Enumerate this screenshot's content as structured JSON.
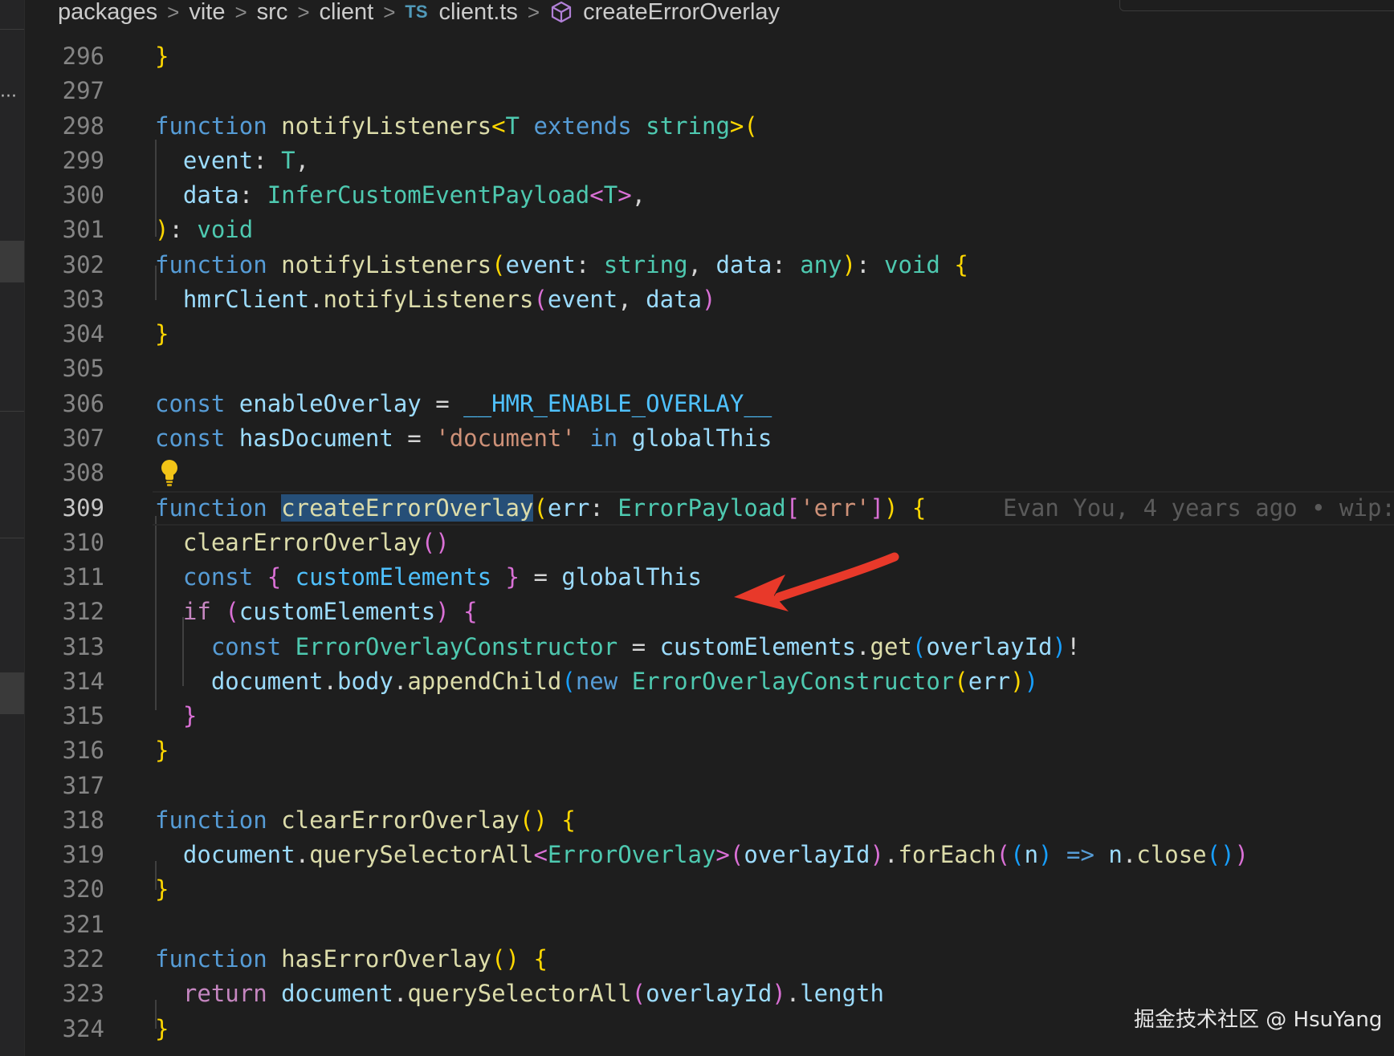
{
  "breadcrumb": {
    "items": [
      "packages",
      "vite",
      "src",
      "client"
    ],
    "file_badge": "TS",
    "file": "client.ts",
    "symbol": "createErrorOverlay",
    "separator": ">"
  },
  "editor": {
    "current_line": "309",
    "blame": "Evan You, 4 years ago • wip:",
    "line_numbers": [
      "296",
      "297",
      "298",
      "299",
      "300",
      "301",
      "302",
      "303",
      "304",
      "305",
      "306",
      "307",
      "308",
      "309",
      "310",
      "311",
      "312",
      "313",
      "314",
      "315",
      "316",
      "317",
      "318",
      "319",
      "320",
      "321",
      "322",
      "323",
      "324"
    ],
    "lines": [
      [
        [
          "b1",
          "}"
        ]
      ],
      [],
      [
        [
          "kw",
          "function"
        ],
        [
          "pn",
          " "
        ],
        [
          "fn",
          "notifyListeners"
        ],
        [
          "b1",
          "<"
        ],
        [
          "ty",
          "T"
        ],
        [
          "pn",
          " "
        ],
        [
          "kw",
          "extends"
        ],
        [
          "pn",
          " "
        ],
        [
          "ty",
          "string"
        ],
        [
          "b1",
          ">("
        ]
      ],
      [
        [
          "pn",
          "  "
        ],
        [
          "vr",
          "event"
        ],
        [
          "pn",
          ": "
        ],
        [
          "ty",
          "T"
        ],
        [
          "pn",
          ","
        ]
      ],
      [
        [
          "pn",
          "  "
        ],
        [
          "vr",
          "data"
        ],
        [
          "pn",
          ": "
        ],
        [
          "ty",
          "InferCustomEventPayload"
        ],
        [
          "b2",
          "<"
        ],
        [
          "ty",
          "T"
        ],
        [
          "b2",
          ">"
        ],
        [
          "pn",
          ","
        ]
      ],
      [
        [
          "b1",
          ")"
        ],
        [
          "pn",
          ": "
        ],
        [
          "ty",
          "void"
        ]
      ],
      [
        [
          "kw",
          "function"
        ],
        [
          "pn",
          " "
        ],
        [
          "fn",
          "notifyListeners"
        ],
        [
          "b1",
          "("
        ],
        [
          "vr",
          "event"
        ],
        [
          "pn",
          ": "
        ],
        [
          "ty",
          "string"
        ],
        [
          "pn",
          ", "
        ],
        [
          "vr",
          "data"
        ],
        [
          "pn",
          ": "
        ],
        [
          "ty",
          "any"
        ],
        [
          "b1",
          ")"
        ],
        [
          "pn",
          ": "
        ],
        [
          "ty",
          "void"
        ],
        [
          "pn",
          " "
        ],
        [
          "b1",
          "{"
        ]
      ],
      [
        [
          "pn",
          "  "
        ],
        [
          "vr",
          "hmrClient"
        ],
        [
          "pn",
          "."
        ],
        [
          "fn",
          "notifyListeners"
        ],
        [
          "b2",
          "("
        ],
        [
          "vr",
          "event"
        ],
        [
          "pn",
          ", "
        ],
        [
          "vr",
          "data"
        ],
        [
          "b2",
          ")"
        ]
      ],
      [
        [
          "b1",
          "}"
        ]
      ],
      [],
      [
        [
          "kw",
          "const"
        ],
        [
          "pn",
          " "
        ],
        [
          "vr",
          "enableOverlay"
        ],
        [
          "pn",
          " = "
        ],
        [
          "cst",
          "__HMR_ENABLE_OVERLAY__"
        ]
      ],
      [
        [
          "kw",
          "const"
        ],
        [
          "pn",
          " "
        ],
        [
          "vr",
          "hasDocument"
        ],
        [
          "pn",
          " = "
        ],
        [
          "str",
          "'document'"
        ],
        [
          "pn",
          " "
        ],
        [
          "kw",
          "in"
        ],
        [
          "pn",
          " "
        ],
        [
          "vr",
          "globalThis"
        ]
      ],
      [],
      [
        [
          "kw",
          "function"
        ],
        [
          "pn",
          " "
        ],
        [
          "fn hl",
          "createErrorOverlay"
        ],
        [
          "b1",
          "("
        ],
        [
          "vr",
          "err"
        ],
        [
          "pn",
          ": "
        ],
        [
          "ty",
          "ErrorPayload"
        ],
        [
          "b2",
          "["
        ],
        [
          "str",
          "'err'"
        ],
        [
          "b2",
          "]"
        ],
        [
          "b1",
          ")"
        ],
        [
          "pn",
          " "
        ],
        [
          "b1",
          "{"
        ]
      ],
      [
        [
          "pn",
          "  "
        ],
        [
          "fn",
          "clearErrorOverlay"
        ],
        [
          "b2",
          "()"
        ]
      ],
      [
        [
          "pn",
          "  "
        ],
        [
          "kw",
          "const"
        ],
        [
          "pn",
          " "
        ],
        [
          "b2",
          "{"
        ],
        [
          "pn",
          " "
        ],
        [
          "cst",
          "customElements"
        ],
        [
          "pn",
          " "
        ],
        [
          "b2",
          "}"
        ],
        [
          "pn",
          " = "
        ],
        [
          "vr",
          "globalThis"
        ]
      ],
      [
        [
          "pn",
          "  "
        ],
        [
          "ctl",
          "if"
        ],
        [
          "pn",
          " "
        ],
        [
          "b2",
          "("
        ],
        [
          "vr",
          "customElements"
        ],
        [
          "b2",
          ")"
        ],
        [
          "pn",
          " "
        ],
        [
          "b2",
          "{"
        ]
      ],
      [
        [
          "pn",
          "    "
        ],
        [
          "kw",
          "const"
        ],
        [
          "pn",
          " "
        ],
        [
          "ty",
          "ErrorOverlayConstructor"
        ],
        [
          "pn",
          " = "
        ],
        [
          "vr",
          "customElements"
        ],
        [
          "pn",
          "."
        ],
        [
          "fn",
          "get"
        ],
        [
          "b3",
          "("
        ],
        [
          "vr",
          "overlayId"
        ],
        [
          "b3",
          ")"
        ],
        [
          "pn",
          "!"
        ]
      ],
      [
        [
          "pn",
          "    "
        ],
        [
          "vr",
          "document"
        ],
        [
          "pn",
          "."
        ],
        [
          "vr",
          "body"
        ],
        [
          "pn",
          "."
        ],
        [
          "fn",
          "appendChild"
        ],
        [
          "b3",
          "("
        ],
        [
          "kw",
          "new"
        ],
        [
          "pn",
          " "
        ],
        [
          "ty",
          "ErrorOverlayConstructor"
        ],
        [
          "b1",
          "("
        ],
        [
          "vr",
          "err"
        ],
        [
          "b1",
          ")"
        ],
        [
          "b3",
          ")"
        ]
      ],
      [
        [
          "pn",
          "  "
        ],
        [
          "b2",
          "}"
        ]
      ],
      [
        [
          "b1",
          "}"
        ]
      ],
      [],
      [
        [
          "kw",
          "function"
        ],
        [
          "pn",
          " "
        ],
        [
          "fn",
          "clearErrorOverlay"
        ],
        [
          "b1",
          "()"
        ],
        [
          "pn",
          " "
        ],
        [
          "b1",
          "{"
        ]
      ],
      [
        [
          "pn",
          "  "
        ],
        [
          "vr",
          "document"
        ],
        [
          "pn",
          "."
        ],
        [
          "fn",
          "querySelectorAll"
        ],
        [
          "b2",
          "<"
        ],
        [
          "ty",
          "ErrorOverlay"
        ],
        [
          "b2",
          ">("
        ],
        [
          "vr",
          "overlayId"
        ],
        [
          "b2",
          ")"
        ],
        [
          "pn",
          "."
        ],
        [
          "fn",
          "forEach"
        ],
        [
          "b2",
          "("
        ],
        [
          "b3",
          "("
        ],
        [
          "vr",
          "n"
        ],
        [
          "b3",
          ")"
        ],
        [
          "pn",
          " "
        ],
        [
          "kw",
          "=>"
        ],
        [
          "pn",
          " "
        ],
        [
          "vr",
          "n"
        ],
        [
          "pn",
          "."
        ],
        [
          "fn",
          "close"
        ],
        [
          "b3",
          "()"
        ],
        [
          "b2",
          ")"
        ]
      ],
      [
        [
          "b1",
          "}"
        ]
      ],
      [],
      [
        [
          "kw",
          "function"
        ],
        [
          "pn",
          " "
        ],
        [
          "fn",
          "hasErrorOverlay"
        ],
        [
          "b1",
          "()"
        ],
        [
          "pn",
          " "
        ],
        [
          "b1",
          "{"
        ]
      ],
      [
        [
          "pn",
          "  "
        ],
        [
          "ctl",
          "return"
        ],
        [
          "pn",
          " "
        ],
        [
          "vr",
          "document"
        ],
        [
          "pn",
          "."
        ],
        [
          "fn",
          "querySelectorAll"
        ],
        [
          "b2",
          "("
        ],
        [
          "vr",
          "overlayId"
        ],
        [
          "b2",
          ")"
        ],
        [
          "pn",
          "."
        ],
        [
          "vr",
          "length"
        ]
      ],
      [
        [
          "b1",
          "}"
        ]
      ]
    ]
  },
  "colors": {
    "background": "#1e1e1e",
    "selection": "#264f78",
    "arrow": "#e8392a",
    "lightbulb": "#f2c417"
  },
  "icons": {
    "symbol_icon": "cube-icon",
    "lightbulb": "lightbulb-icon",
    "annotation": "red-arrow"
  },
  "watermark": "掘金技术社区 @ HsuYang"
}
